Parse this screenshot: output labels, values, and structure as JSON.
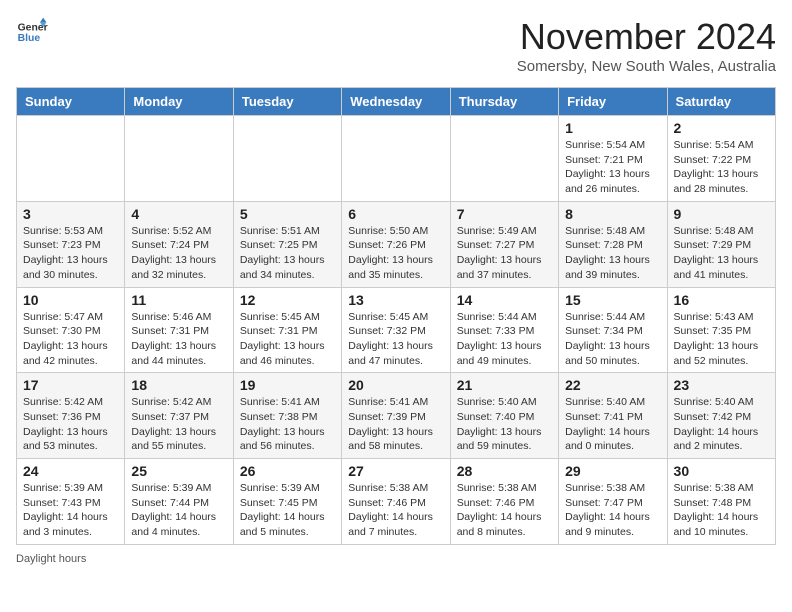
{
  "header": {
    "logo_general": "General",
    "logo_blue": "Blue",
    "month_title": "November 2024",
    "location": "Somersby, New South Wales, Australia"
  },
  "days_of_week": [
    "Sunday",
    "Monday",
    "Tuesday",
    "Wednesday",
    "Thursday",
    "Friday",
    "Saturday"
  ],
  "weeks": [
    [
      {
        "day": "",
        "sunrise": "",
        "sunset": "",
        "daylight": ""
      },
      {
        "day": "",
        "sunrise": "",
        "sunset": "",
        "daylight": ""
      },
      {
        "day": "",
        "sunrise": "",
        "sunset": "",
        "daylight": ""
      },
      {
        "day": "",
        "sunrise": "",
        "sunset": "",
        "daylight": ""
      },
      {
        "day": "",
        "sunrise": "",
        "sunset": "",
        "daylight": ""
      },
      {
        "day": "1",
        "sunrise": "Sunrise: 5:54 AM",
        "sunset": "Sunset: 7:21 PM",
        "daylight": "Daylight: 13 hours and 26 minutes."
      },
      {
        "day": "2",
        "sunrise": "Sunrise: 5:54 AM",
        "sunset": "Sunset: 7:22 PM",
        "daylight": "Daylight: 13 hours and 28 minutes."
      }
    ],
    [
      {
        "day": "3",
        "sunrise": "Sunrise: 5:53 AM",
        "sunset": "Sunset: 7:23 PM",
        "daylight": "Daylight: 13 hours and 30 minutes."
      },
      {
        "day": "4",
        "sunrise": "Sunrise: 5:52 AM",
        "sunset": "Sunset: 7:24 PM",
        "daylight": "Daylight: 13 hours and 32 minutes."
      },
      {
        "day": "5",
        "sunrise": "Sunrise: 5:51 AM",
        "sunset": "Sunset: 7:25 PM",
        "daylight": "Daylight: 13 hours and 34 minutes."
      },
      {
        "day": "6",
        "sunrise": "Sunrise: 5:50 AM",
        "sunset": "Sunset: 7:26 PM",
        "daylight": "Daylight: 13 hours and 35 minutes."
      },
      {
        "day": "7",
        "sunrise": "Sunrise: 5:49 AM",
        "sunset": "Sunset: 7:27 PM",
        "daylight": "Daylight: 13 hours and 37 minutes."
      },
      {
        "day": "8",
        "sunrise": "Sunrise: 5:48 AM",
        "sunset": "Sunset: 7:28 PM",
        "daylight": "Daylight: 13 hours and 39 minutes."
      },
      {
        "day": "9",
        "sunrise": "Sunrise: 5:48 AM",
        "sunset": "Sunset: 7:29 PM",
        "daylight": "Daylight: 13 hours and 41 minutes."
      }
    ],
    [
      {
        "day": "10",
        "sunrise": "Sunrise: 5:47 AM",
        "sunset": "Sunset: 7:30 PM",
        "daylight": "Daylight: 13 hours and 42 minutes."
      },
      {
        "day": "11",
        "sunrise": "Sunrise: 5:46 AM",
        "sunset": "Sunset: 7:31 PM",
        "daylight": "Daylight: 13 hours and 44 minutes."
      },
      {
        "day": "12",
        "sunrise": "Sunrise: 5:45 AM",
        "sunset": "Sunset: 7:31 PM",
        "daylight": "Daylight: 13 hours and 46 minutes."
      },
      {
        "day": "13",
        "sunrise": "Sunrise: 5:45 AM",
        "sunset": "Sunset: 7:32 PM",
        "daylight": "Daylight: 13 hours and 47 minutes."
      },
      {
        "day": "14",
        "sunrise": "Sunrise: 5:44 AM",
        "sunset": "Sunset: 7:33 PM",
        "daylight": "Daylight: 13 hours and 49 minutes."
      },
      {
        "day": "15",
        "sunrise": "Sunrise: 5:44 AM",
        "sunset": "Sunset: 7:34 PM",
        "daylight": "Daylight: 13 hours and 50 minutes."
      },
      {
        "day": "16",
        "sunrise": "Sunrise: 5:43 AM",
        "sunset": "Sunset: 7:35 PM",
        "daylight": "Daylight: 13 hours and 52 minutes."
      }
    ],
    [
      {
        "day": "17",
        "sunrise": "Sunrise: 5:42 AM",
        "sunset": "Sunset: 7:36 PM",
        "daylight": "Daylight: 13 hours and 53 minutes."
      },
      {
        "day": "18",
        "sunrise": "Sunrise: 5:42 AM",
        "sunset": "Sunset: 7:37 PM",
        "daylight": "Daylight: 13 hours and 55 minutes."
      },
      {
        "day": "19",
        "sunrise": "Sunrise: 5:41 AM",
        "sunset": "Sunset: 7:38 PM",
        "daylight": "Daylight: 13 hours and 56 minutes."
      },
      {
        "day": "20",
        "sunrise": "Sunrise: 5:41 AM",
        "sunset": "Sunset: 7:39 PM",
        "daylight": "Daylight: 13 hours and 58 minutes."
      },
      {
        "day": "21",
        "sunrise": "Sunrise: 5:40 AM",
        "sunset": "Sunset: 7:40 PM",
        "daylight": "Daylight: 13 hours and 59 minutes."
      },
      {
        "day": "22",
        "sunrise": "Sunrise: 5:40 AM",
        "sunset": "Sunset: 7:41 PM",
        "daylight": "Daylight: 14 hours and 0 minutes."
      },
      {
        "day": "23",
        "sunrise": "Sunrise: 5:40 AM",
        "sunset": "Sunset: 7:42 PM",
        "daylight": "Daylight: 14 hours and 2 minutes."
      }
    ],
    [
      {
        "day": "24",
        "sunrise": "Sunrise: 5:39 AM",
        "sunset": "Sunset: 7:43 PM",
        "daylight": "Daylight: 14 hours and 3 minutes."
      },
      {
        "day": "25",
        "sunrise": "Sunrise: 5:39 AM",
        "sunset": "Sunset: 7:44 PM",
        "daylight": "Daylight: 14 hours and 4 minutes."
      },
      {
        "day": "26",
        "sunrise": "Sunrise: 5:39 AM",
        "sunset": "Sunset: 7:45 PM",
        "daylight": "Daylight: 14 hours and 5 minutes."
      },
      {
        "day": "27",
        "sunrise": "Sunrise: 5:38 AM",
        "sunset": "Sunset: 7:46 PM",
        "daylight": "Daylight: 14 hours and 7 minutes."
      },
      {
        "day": "28",
        "sunrise": "Sunrise: 5:38 AM",
        "sunset": "Sunset: 7:46 PM",
        "daylight": "Daylight: 14 hours and 8 minutes."
      },
      {
        "day": "29",
        "sunrise": "Sunrise: 5:38 AM",
        "sunset": "Sunset: 7:47 PM",
        "daylight": "Daylight: 14 hours and 9 minutes."
      },
      {
        "day": "30",
        "sunrise": "Sunrise: 5:38 AM",
        "sunset": "Sunset: 7:48 PM",
        "daylight": "Daylight: 14 hours and 10 minutes."
      }
    ]
  ],
  "footer": {
    "daylight_hours_label": "Daylight hours"
  }
}
